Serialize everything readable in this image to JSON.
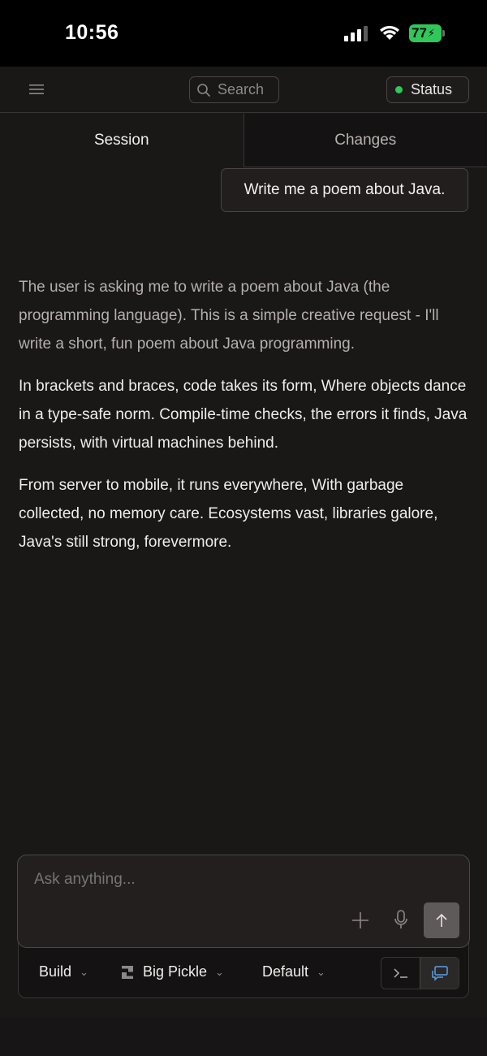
{
  "status_bar": {
    "time": "10:56",
    "battery": "77"
  },
  "toolbar": {
    "search_label": "Search",
    "status_label": "Status",
    "status_color": "#31c759"
  },
  "tabs": [
    {
      "label": "Session",
      "active": true
    },
    {
      "label": "Changes",
      "active": false
    }
  ],
  "conversation": {
    "user_message": "Write me a poem about Java.",
    "reasoning": "The user is asking me to write a poem about Java (the programming language). This is a simple creative request - I'll write a short, fun poem about Java programming.",
    "stanzas": [
      "In brackets and braces, code takes its form, Where objects dance in a type-safe norm. Compile-time checks, the errors it finds, Java persists, with virtual machines behind.",
      "From server to mobile, it runs everywhere, With garbage collected, no memory care. Ecosystems vast, libraries galore, Java's still strong, forevermore."
    ]
  },
  "composer": {
    "placeholder": "Ask anything...",
    "agent": "Build",
    "model": "Big Pickle",
    "variant": "Default"
  },
  "icons": {
    "menu": "hamburger-icon",
    "search": "search-icon",
    "plus": "plus-icon",
    "mic": "microphone-icon",
    "send": "arrow-up-icon",
    "terminal": "terminal-icon",
    "chat": "chat-icon"
  }
}
